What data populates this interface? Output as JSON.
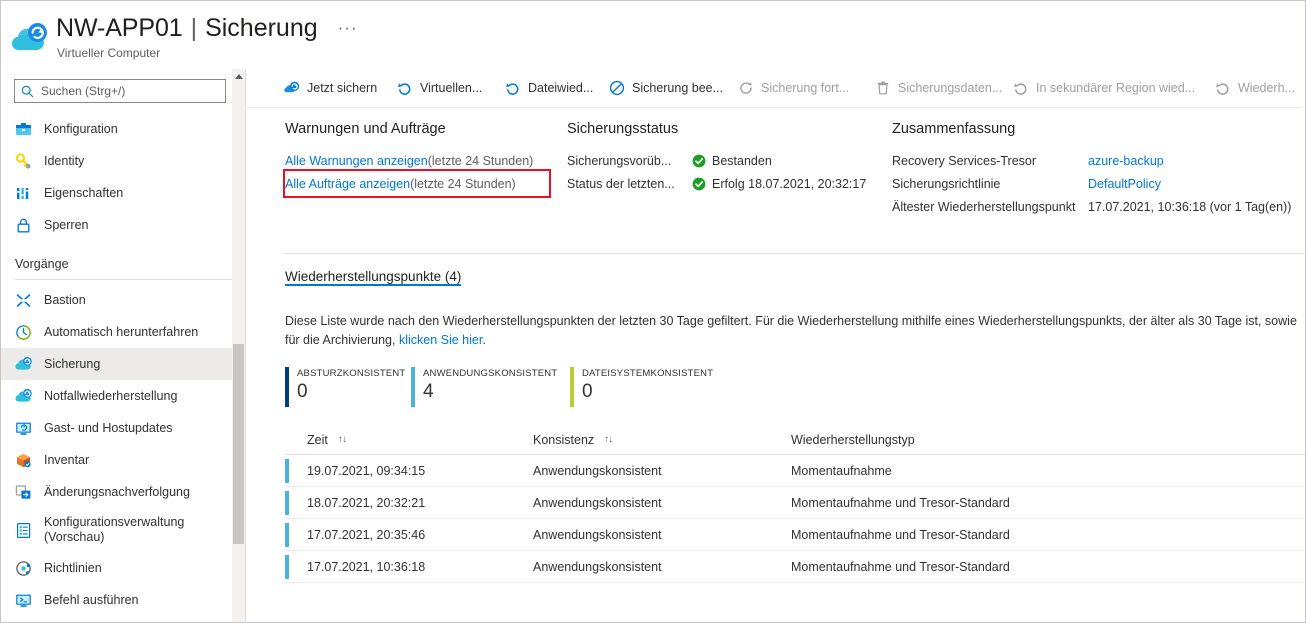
{
  "header": {
    "icon": "azure-backup-vm-icon",
    "resource_name": "NW-APP01",
    "separator": "|",
    "blade_name": "Sicherung",
    "more_label": "···",
    "subtitle": "Virtueller Computer"
  },
  "search": {
    "placeholder": "Suchen (Strg+/)",
    "icon": "search-icon",
    "collapse_label": "«"
  },
  "sidebar": {
    "items": [
      {
        "label": "Konfiguration",
        "icon": "configuration-icon",
        "selected": false
      },
      {
        "label": "Identity",
        "icon": "key-icon",
        "selected": false
      },
      {
        "label": "Eigenschaften",
        "icon": "properties-icon",
        "selected": false
      },
      {
        "label": "Sperren",
        "icon": "lock-icon",
        "selected": false
      }
    ],
    "group_label": "Vorgänge",
    "group_items": [
      {
        "label": "Bastion",
        "icon": "bastion-icon",
        "selected": false
      },
      {
        "label": "Automatisch herunterfahren",
        "icon": "clock-icon",
        "selected": false
      },
      {
        "label": "Sicherung",
        "icon": "backup-cloud-icon",
        "selected": true
      },
      {
        "label": "Notfallwiederherstellung",
        "icon": "disaster-recovery-icon",
        "selected": false
      },
      {
        "label": "Gast- und Hostupdates",
        "icon": "updates-icon",
        "selected": false
      },
      {
        "label": "Inventar",
        "icon": "inventory-icon",
        "selected": false
      },
      {
        "label": "Änderungsnachverfolgung",
        "icon": "change-tracking-icon",
        "selected": false
      },
      {
        "label": "Konfigurationsverwaltung (Vorschau)",
        "icon": "config-management-icon",
        "selected": false
      },
      {
        "label": "Richtlinien",
        "icon": "policy-icon",
        "selected": false
      },
      {
        "label": "Befehl ausführen",
        "icon": "run-command-icon",
        "selected": false
      }
    ]
  },
  "toolbar": {
    "items": [
      {
        "label": "Jetzt sichern",
        "icon": "backup-now-icon",
        "disabled": false
      },
      {
        "label": "Virtuellen...",
        "icon": "restore-vm-icon",
        "disabled": false
      },
      {
        "label": "Dateiwied...",
        "icon": "file-recovery-icon",
        "disabled": false
      },
      {
        "label": "Sicherung bee...",
        "icon": "stop-backup-icon",
        "disabled": false
      },
      {
        "label": "Sicherung fort...",
        "icon": "resume-backup-icon",
        "disabled": true
      },
      {
        "label": "Sicherungsdaten...",
        "icon": "delete-backup-data-icon",
        "disabled": true
      },
      {
        "label": "In sekundärer Region wied...",
        "icon": "restore-secondary-region-icon",
        "disabled": true
      },
      {
        "label": "Wiederh...",
        "icon": "restore-icon",
        "disabled": true
      }
    ]
  },
  "summary": {
    "alerts": {
      "title": "Warnungen und Aufträge",
      "rows": [
        {
          "link": "Alle Warnungen anzeigen",
          "suffix": " (letzte 24 Stunden)",
          "highlighted": false
        },
        {
          "link": "Alle Aufträge anzeigen",
          "suffix": " (letzte 24 Stunden)",
          "highlighted": true
        }
      ]
    },
    "status": {
      "title": "Sicherungsstatus",
      "rows": [
        {
          "label": "Sicherungsvorüb...",
          "icon": "success-check-icon",
          "value": "Bestanden"
        },
        {
          "label": "Status der letzten...",
          "icon": "success-check-icon",
          "value": "Erfolg 18.07.2021, 20:32:17"
        }
      ]
    },
    "overview": {
      "title": "Zusammenfassung",
      "rows": [
        {
          "label": "Recovery Services-Tresor",
          "value": "azure-backup",
          "is_link": true
        },
        {
          "label": "Sicherungsrichtlinie",
          "value": "DefaultPolicy",
          "is_link": true
        },
        {
          "label": "Ältester Wiederherstellungspunkt",
          "value": "17.07.2021, 10:36:18 (vor 1 Tag(en))",
          "is_link": false
        }
      ]
    }
  },
  "recovery_section": {
    "tab_label": "Wiederherstellungspunkte (4)",
    "description_pre": "Diese Liste wurde nach den Wiederherstellungspunkten der letzten 30 Tage gefiltert. Für die Wiederherstellung mithilfe eines Wiederherstellungspunkts, der älter als 30 Tage ist, sowie für die Archivierung, ",
    "description_link": "klicken Sie hier",
    "description_post": ".",
    "stats": [
      {
        "label": "Absturzkonsistent",
        "value": "0",
        "color": "#003f7d"
      },
      {
        "label": "Anwendungskonsistent",
        "value": "4",
        "color": "#4db2dc"
      },
      {
        "label": "Dateisystemkonsistent",
        "value": "0",
        "color": "#b9cf30"
      }
    ],
    "table": {
      "columns": [
        "Zeit",
        "Konsistenz",
        "Wiederherstellungstyp"
      ],
      "sortable": [
        true,
        true,
        false
      ],
      "sort_glyph": "↑↓",
      "rows": [
        {
          "zeit": "19.07.2021, 09:34:15",
          "konsistenz": "Anwendungskonsistent",
          "typ": "Momentaufnahme"
        },
        {
          "zeit": "18.07.2021, 20:32:21",
          "konsistenz": "Anwendungskonsistent",
          "typ": "Momentaufnahme und Tresor-Standard"
        },
        {
          "zeit": "17.07.2021, 20:35:46",
          "konsistenz": "Anwendungskonsistent",
          "typ": "Momentaufnahme und Tresor-Standard"
        },
        {
          "zeit": "17.07.2021, 10:36:18",
          "konsistenz": "Anwendungskonsistent",
          "typ": "Momentaufnahme und Tresor-Standard"
        }
      ]
    }
  },
  "colors": {
    "accent": "#0078d4",
    "link": "#0078d4",
    "success": "#107c10",
    "highlight_box": "#e81123",
    "row_accent": "#4db2dc"
  }
}
